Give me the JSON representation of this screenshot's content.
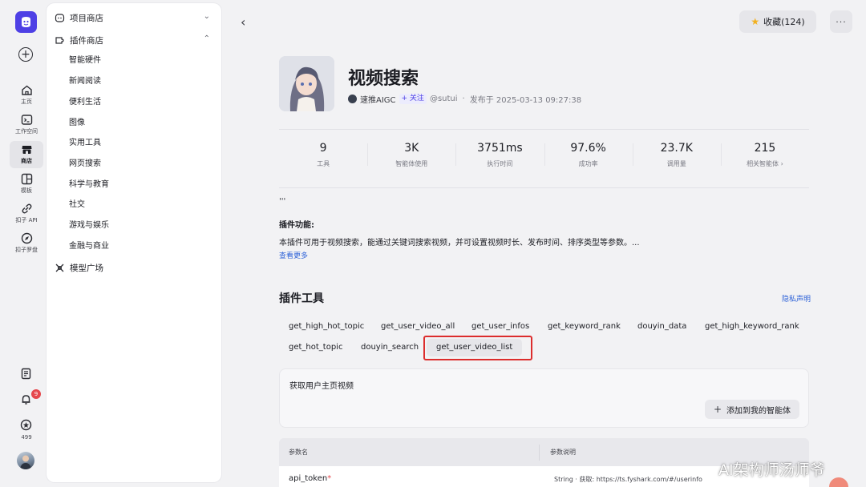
{
  "rail": {
    "items": [
      {
        "label": "主页",
        "icon": "home-icon"
      },
      {
        "label": "工作空间",
        "icon": "terminal-icon"
      },
      {
        "label": "商店",
        "icon": "store-icon",
        "active": true
      },
      {
        "label": "模板",
        "icon": "template-icon"
      },
      {
        "label": "扣子 API",
        "icon": "api-icon"
      },
      {
        "label": "扣子罗盘",
        "icon": "compass-icon"
      }
    ],
    "notification_count": "9",
    "credits": "499"
  },
  "categories": {
    "project_store": "项目商店",
    "plugin_store": "插件商店",
    "plugin_items": [
      "智能硬件",
      "新闻阅读",
      "便利生活",
      "图像",
      "实用工具",
      "网页搜索",
      "科学与教育",
      "社交",
      "游戏与娱乐",
      "金融与商业"
    ],
    "model_square": "模型广场"
  },
  "header": {
    "back": "‹",
    "favorite": "收藏(124)",
    "more": "···"
  },
  "plugin": {
    "title": "视频搜索",
    "author": "速推AIGC",
    "follow": "+ 关注",
    "handle": "@sutui",
    "dot": "·",
    "published": "发布于 2025-03-13 09:27:38"
  },
  "stats": [
    {
      "value": "9",
      "label": "工具"
    },
    {
      "value": "3K",
      "label": "智能体使用"
    },
    {
      "value": "3751ms",
      "label": "执行时间"
    },
    {
      "value": "97.6%",
      "label": "成功率"
    },
    {
      "value": "23.7K",
      "label": "调用量"
    },
    {
      "value": "215",
      "label": "相关智能体 ›"
    }
  ],
  "description": {
    "quote": "'''",
    "feature_title": "插件功能:",
    "feature_text": "本插件可用于视频搜索，能通过关键词搜索视频，并可设置视频时长、发布时间、排序类型等参数。...",
    "see_more": "查看更多"
  },
  "tools": {
    "title": "插件工具",
    "privacy": "隐私声明",
    "items": [
      "get_high_hot_topic",
      "get_user_video_all",
      "get_user_infos",
      "get_keyword_rank",
      "douyin_data",
      "get_high_keyword_rank",
      "get_hot_topic",
      "douyin_search",
      "get_user_video_list"
    ],
    "active": "get_user_video_list",
    "active_desc": "获取用户主页视频",
    "add_button": "添加到我的智能体"
  },
  "params": {
    "col_name": "参数名",
    "col_desc": "参数说明",
    "rows": [
      {
        "name": "api_token",
        "required": "*",
        "desc": "String · 获取: https://ts.fyshark.com/#/userinfo"
      }
    ]
  },
  "watermark": "AI架构师汤师爷",
  "colors": {
    "accent": "#4e40e5",
    "highlight": "#dc2d2d",
    "link": "#2f63d8",
    "star": "#f2b01e"
  }
}
